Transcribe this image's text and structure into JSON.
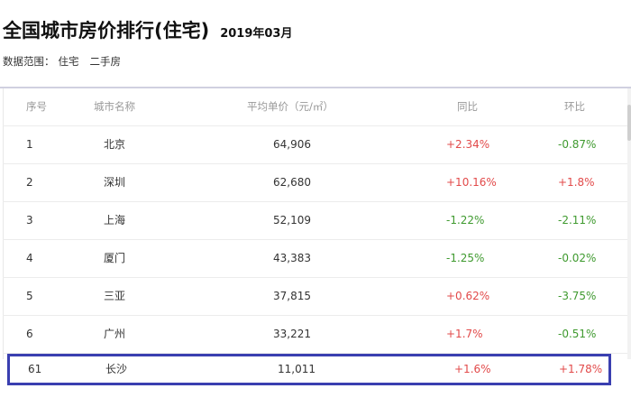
{
  "header": {
    "title": "全国城市房价排行(住宅)",
    "date": "2019年03月",
    "scope_label": "数据范围：",
    "scope_values": [
      "住宅",
      "二手房"
    ]
  },
  "table": {
    "columns": [
      "序号",
      "城市名称",
      "平均单价（元/㎡）",
      "同比",
      "环比"
    ],
    "rows": [
      {
        "rank": "1",
        "city": "北京",
        "price": "64,906",
        "yoy": "+2.34%",
        "mom": "-0.87%"
      },
      {
        "rank": "2",
        "city": "深圳",
        "price": "62,680",
        "yoy": "+10.16%",
        "mom": "+1.8%"
      },
      {
        "rank": "3",
        "city": "上海",
        "price": "52,109",
        "yoy": "-1.22%",
        "mom": "-2.11%"
      },
      {
        "rank": "4",
        "city": "厦门",
        "price": "43,383",
        "yoy": "-1.25%",
        "mom": "-0.02%"
      },
      {
        "rank": "5",
        "city": "三亚",
        "price": "37,815",
        "yoy": "+0.62%",
        "mom": "-3.75%"
      },
      {
        "rank": "6",
        "city": "广州",
        "price": "33,221",
        "yoy": "+1.7%",
        "mom": "-0.51%"
      }
    ],
    "highlighted_row": {
      "rank": "61",
      "city": "长沙",
      "price": "11,011",
      "yoy": "+1.6%",
      "mom": "+1.78%"
    }
  },
  "colors": {
    "up": "#e24a4a",
    "down": "#3f9a2f",
    "highlight_border": "#3a3fb0"
  }
}
